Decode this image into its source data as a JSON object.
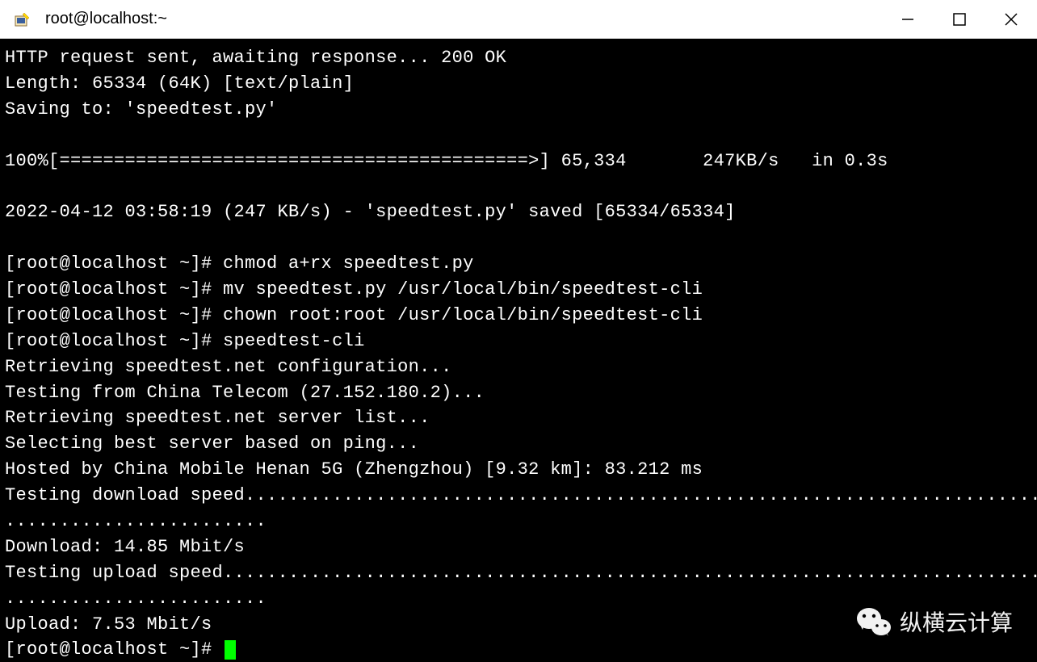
{
  "window": {
    "title": "root@localhost:~"
  },
  "terminal": {
    "lines": [
      "HTTP request sent, awaiting response... 200 OK",
      "Length: 65334 (64K) [text/plain]",
      "Saving to: 'speedtest.py'",
      "",
      "100%[===========================================>] 65,334       247KB/s   in 0.3s",
      "",
      "2022-04-12 03:58:19 (247 KB/s) - 'speedtest.py' saved [65334/65334]",
      "",
      "[root@localhost ~]# chmod a+rx speedtest.py",
      "[root@localhost ~]# mv speedtest.py /usr/local/bin/speedtest-cli",
      "[root@localhost ~]# chown root:root /usr/local/bin/speedtest-cli",
      "[root@localhost ~]# speedtest-cli",
      "Retrieving speedtest.net configuration...",
      "Testing from China Telecom (27.152.180.2)...",
      "Retrieving speedtest.net server list...",
      "Selecting best server based on ping...",
      "Hosted by China Mobile Henan 5G (Zhengzhou) [9.32 km]: 83.212 ms",
      "Testing download speed................................................................................",
      "........................",
      "Download: 14.85 Mbit/s",
      "Testing upload speed................................................................................................",
      "........................",
      "Upload: 7.53 Mbit/s"
    ],
    "prompt_final": "[root@localhost ~]# "
  },
  "watermark": {
    "text": "纵横云计算"
  }
}
